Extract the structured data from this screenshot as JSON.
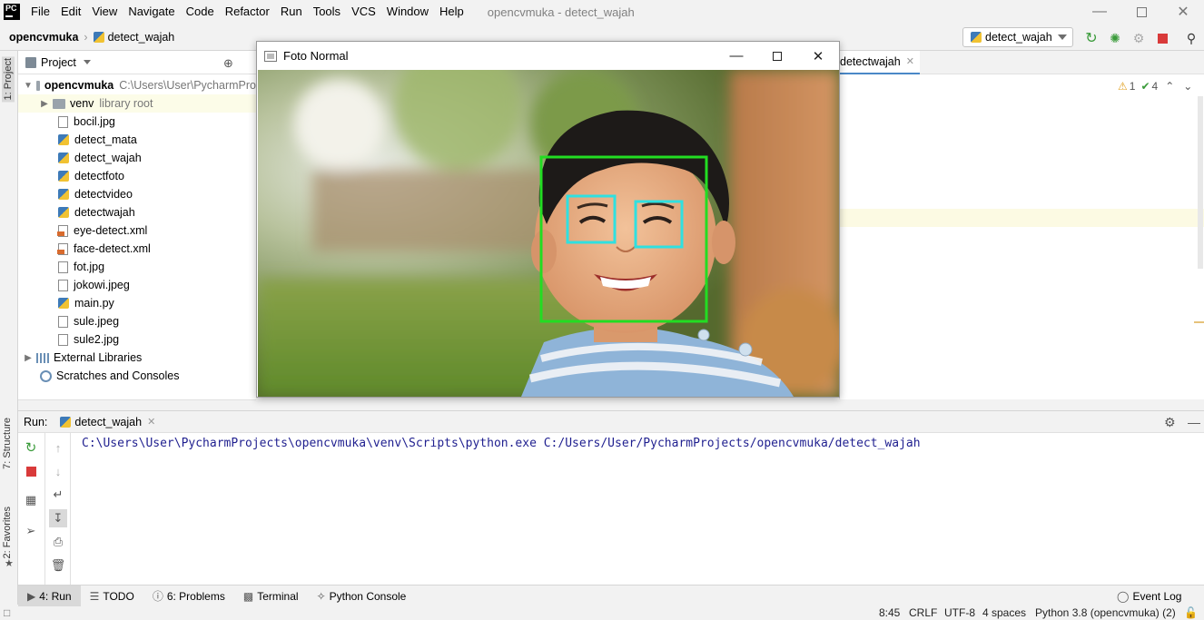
{
  "menubar": {
    "logo": "PC",
    "items": [
      "File",
      "Edit",
      "View",
      "Navigate",
      "Code",
      "Refactor",
      "Run",
      "Tools",
      "VCS",
      "Window",
      "Help"
    ],
    "window_title": "opencvmuka - detect_wajah"
  },
  "navbar": {
    "project": "opencvmuka",
    "file": "detect_wajah",
    "run_config": "detect_wajah"
  },
  "sidebar": {
    "project_tab": "1: Project",
    "structure_tab": "7: Structure",
    "favorites_tab": "2: Favorites"
  },
  "project_panel": {
    "title": "Project",
    "root_name": "opencvmuka",
    "root_path": "C:\\Users\\User\\PycharmPro",
    "venv": "venv",
    "venv_hint": "library root",
    "files": [
      "bocil.jpg",
      "detect_mata",
      "detect_wajah",
      "detectfoto",
      "detectvideo",
      "detectwajah",
      "eye-detect.xml",
      "face-detect.xml",
      "fot.jpg",
      "jokowi.jpeg",
      "main.py",
      "sule.jpeg",
      "sule2.jpg"
    ],
    "external": "External Libraries",
    "scratches": "Scratches and Consoles"
  },
  "editor": {
    "tab_label": "detectwajah",
    "warnings": "1",
    "checks": "4"
  },
  "dialog": {
    "title": "Foto Normal"
  },
  "run_panel": {
    "label": "Run:",
    "tab": "detect_wajah",
    "command": "C:\\Users\\User\\PycharmProjects\\opencvmuka\\venv\\Scripts\\python.exe C:/Users/User/PycharmProjects/opencvmuka/detect_wajah"
  },
  "bottom_tabs": {
    "run": "4: Run",
    "todo": "TODO",
    "problems": "6: Problems",
    "terminal": "Terminal",
    "python_console": "Python Console",
    "event_log": "Event Log"
  },
  "status": {
    "position": "8:45",
    "line_sep": "CRLF",
    "encoding": "UTF-8",
    "indent": "4 spaces",
    "interpreter": "Python 3.8 (opencvmuka) (2)"
  },
  "colors": {
    "face_box": "#22dd22",
    "eye_box": "#2fe0e0",
    "stop_red": "#d93a3a",
    "run_green": "#3a9b3a"
  }
}
